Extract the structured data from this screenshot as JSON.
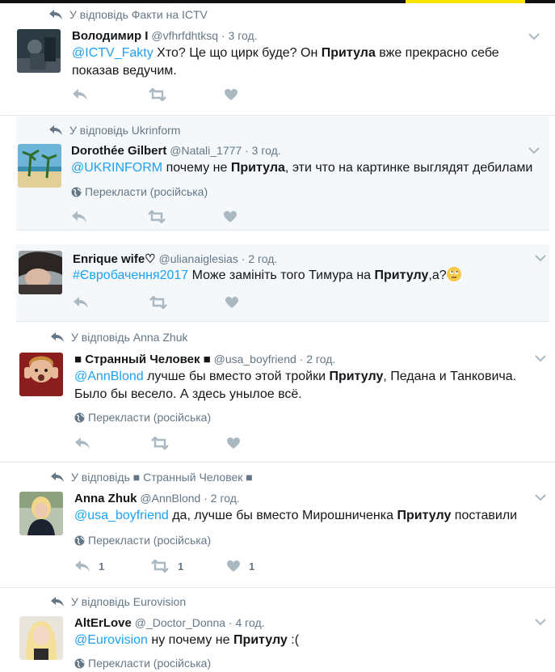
{
  "tweets": [
    {
      "reply_to": "У відповідь Факти на ICTV",
      "fullname": "Володимир І",
      "username": "@vfhrfdhtksq",
      "time": "3 год.",
      "text_parts": [
        {
          "t": "mention",
          "v": "@ICTV_Fakty"
        },
        {
          "t": "text",
          "v": " Хто? Це що цирк буде? Он "
        },
        {
          "t": "bold",
          "v": "Притула"
        },
        {
          "t": "text",
          "v": " вже прекрасно себе показав ведучим."
        }
      ]
    },
    {
      "reply_to": "У відповідь Ukrinform",
      "fullname": "Dorothée Gilbert",
      "username": "@Natali_1777",
      "time": "3 год.",
      "text_parts": [
        {
          "t": "mention",
          "v": "@UKRINFORM"
        },
        {
          "t": "text",
          "v": " почему не "
        },
        {
          "t": "bold",
          "v": "Притула"
        },
        {
          "t": "text",
          "v": ", эти что на картинке выглядят дебилами"
        }
      ],
      "translate": "Перекласти (російська)"
    },
    {
      "fullname": "Enrique wife♡",
      "username": "@ulianaiglesias",
      "time": "2 год.",
      "text_parts": [
        {
          "t": "mention",
          "v": "#Євробачення2017"
        },
        {
          "t": "text",
          "v": " Може замініть того Тимура на "
        },
        {
          "t": "bold",
          "v": "Притулу"
        },
        {
          "t": "text",
          "v": ",а?"
        }
      ]
    },
    {
      "reply_to": "У відповідь Anna Zhuk",
      "fullname": "■ Странный Человек ■",
      "username": "@usa_boyfriend",
      "time": "2 год.",
      "text_parts": [
        {
          "t": "mention",
          "v": "@AnnBlond"
        },
        {
          "t": "text",
          "v": " лучше бы вместо этой тройки "
        },
        {
          "t": "bold",
          "v": "Притулу"
        },
        {
          "t": "text",
          "v": ", Педана и Танковича. Было бы весело. А здесь унылое всё."
        }
      ],
      "translate": "Перекласти (російська)"
    },
    {
      "reply_to": "У відповідь ■ Странный Человек ■",
      "fullname": "Anna Zhuk",
      "username": "@AnnBlond",
      "time": "2 год.",
      "text_parts": [
        {
          "t": "mention",
          "v": "@usa_boyfriend"
        },
        {
          "t": "text",
          "v": " да, лучше бы вместо Мирошниченка "
        },
        {
          "t": "bold",
          "v": "Притулу"
        },
        {
          "t": "text",
          "v": " поставили"
        }
      ],
      "translate": "Перекласти (російська)",
      "counts": {
        "reply": "1",
        "retweet": "1",
        "like": "1"
      }
    },
    {
      "reply_to": "У відповідь Eurovision",
      "fullname": "AltErLove",
      "username": "@_Doctor_Donna",
      "time": "4 год.",
      "text_parts": [
        {
          "t": "mention",
          "v": "@Eurovision"
        },
        {
          "t": "text",
          "v": " ну почему не "
        },
        {
          "t": "bold",
          "v": "Притулу"
        },
        {
          "t": "text",
          "v": " :("
        }
      ],
      "translate": "Перекласти (російська)"
    }
  ],
  "separator": "·",
  "colors": {
    "link": "#1da1f2",
    "muted": "#657786",
    "icon": "#aab8c2",
    "shaded_bg": "#f5f8fa",
    "top_accent": "#f5e400"
  },
  "icons": {
    "reply": "reply-icon",
    "retweet": "retweet-icon",
    "like": "heart-icon",
    "more": "chevron-down-icon",
    "translate": "globe-icon",
    "reply_context": "reply-arrow-icon"
  }
}
